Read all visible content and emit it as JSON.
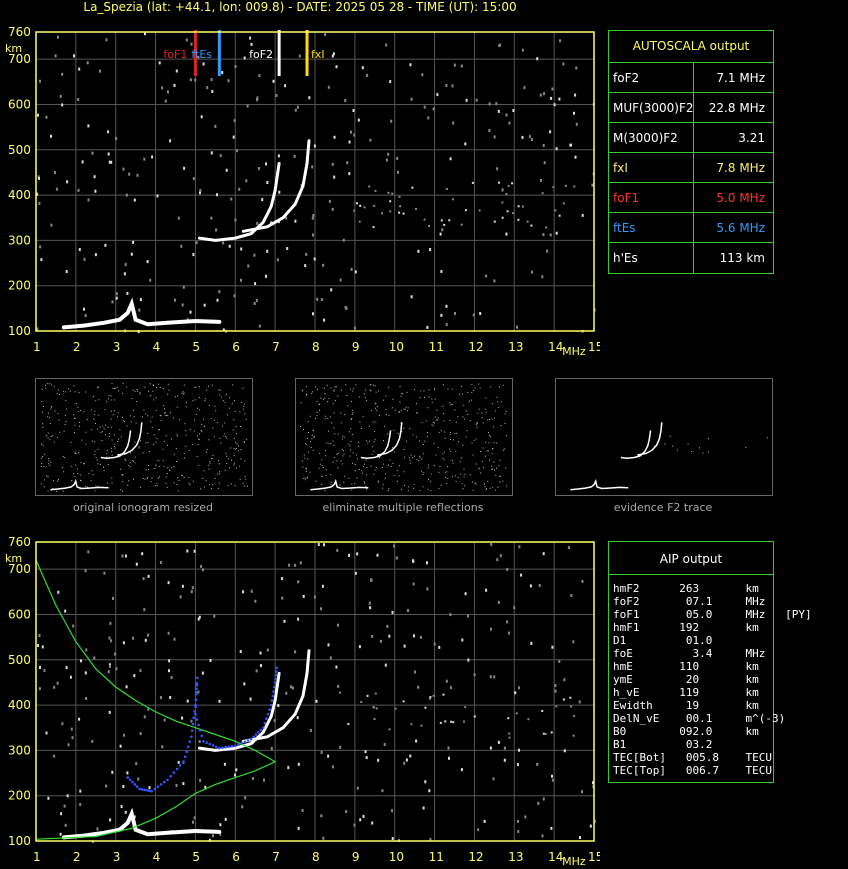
{
  "header": {
    "title": "La_Spezia (lat: +44.1, lon: 009.8) - DATE: 2025 05 28 - TIME (UT): 15:00"
  },
  "axes": {
    "x_ticks": [
      "1",
      "2",
      "3",
      "4",
      "5",
      "6",
      "7",
      "8",
      "9",
      "10",
      "11",
      "12",
      "13",
      "14",
      "15"
    ],
    "x_unit": "MHz",
    "y_ticks": [
      "100",
      "200",
      "300",
      "400",
      "500",
      "600",
      "700",
      "760"
    ],
    "y_unit": "km"
  },
  "markers": {
    "foF1": {
      "label": "foF1",
      "freq": 5.0,
      "color": "#dd2222"
    },
    "ftEs": {
      "label": "ftEs",
      "freq": 5.6,
      "color": "#3399ff"
    },
    "foF2": {
      "label": "foF2",
      "freq": 7.1,
      "color": "#ffffff"
    },
    "fxI": {
      "label": "fxI",
      "freq": 7.8,
      "color": "#ffdd00"
    }
  },
  "autoscala": {
    "title": "AUTOSCALA output",
    "rows": [
      {
        "key": "foF2",
        "value": "7.1 MHz",
        "color": "#ffffff"
      },
      {
        "key": "MUF(3000)F2",
        "value": "22.8 MHz",
        "color": "#ffffff"
      },
      {
        "key": "M(3000)F2",
        "value": "3.21",
        "color": "#ffffff"
      },
      {
        "key": "fxI",
        "value": "7.8 MHz",
        "color": "#ffee66"
      },
      {
        "key": "foF1",
        "value": "5.0 MHz",
        "color": "#ff3333"
      },
      {
        "key": "ftEs",
        "value": "5.6 MHz",
        "color": "#3399ff"
      },
      {
        "key": "h'Es",
        "value": "113    km",
        "color": "#ffffff"
      }
    ]
  },
  "thumbnails": [
    {
      "caption": "original ionogram resized"
    },
    {
      "caption": "eliminate multiple reflections"
    },
    {
      "caption": "evidence F2 trace"
    }
  ],
  "aip": {
    "title": "AIP output",
    "lines": [
      "hmF2      263       km",
      "foF2       07.1     MHz",
      "foF1       05.0     MHz   [PY]",
      "hmF1      192       km",
      "D1         01.0",
      "foE         3.4     MHz",
      "hmE       110       km",
      "ymE        20       km",
      "h_vE      119       km",
      "Ewidth     19       km",
      "DelN_vE    00.1     m^(-3)",
      "B0        092.0     km",
      "B1         03.2",
      "TEC[Bot]   005.8    TECU",
      "TEC[Top]   006.7    TECU"
    ]
  },
  "chart_data": [
    {
      "type": "scatter",
      "xlabel": "MHz",
      "ylabel": "km",
      "xlim": [
        1,
        15
      ],
      "ylim": [
        100,
        760
      ],
      "grid": true,
      "series": [
        {
          "name": "F2 ordinary trace",
          "points": [
            [
              5.1,
              305
            ],
            [
              5.5,
              300
            ],
            [
              6.0,
              305
            ],
            [
              6.4,
              315
            ],
            [
              6.7,
              340
            ],
            [
              6.9,
              375
            ],
            [
              7.0,
              410
            ],
            [
              7.05,
              440
            ],
            [
              7.1,
              470
            ]
          ]
        },
        {
          "name": "F2 extraordinary trace",
          "points": [
            [
              6.2,
              320
            ],
            [
              6.8,
              330
            ],
            [
              7.2,
              350
            ],
            [
              7.5,
              380
            ],
            [
              7.7,
              420
            ],
            [
              7.8,
              470
            ],
            [
              7.85,
              520
            ]
          ]
        },
        {
          "name": "E/Es trace",
          "points": [
            [
              1.7,
              108
            ],
            [
              2.2,
              112
            ],
            [
              2.7,
              118
            ],
            [
              3.1,
              125
            ],
            [
              3.3,
              140
            ],
            [
              3.4,
              160
            ],
            [
              3.5,
              125
            ],
            [
              3.8,
              115
            ],
            [
              4.3,
              118
            ],
            [
              5.0,
              122
            ],
            [
              5.6,
              120
            ]
          ]
        }
      ]
    },
    {
      "type": "line",
      "xlabel": "MHz",
      "ylabel": "km",
      "xlim": [
        1,
        15
      ],
      "ylim": [
        100,
        760
      ],
      "grid": true,
      "series": [
        {
          "name": "electron density profile",
          "points": [
            [
              1.0,
              720
            ],
            [
              1.5,
              620
            ],
            [
              2.0,
              540
            ],
            [
              2.5,
              480
            ],
            [
              3.0,
              440
            ],
            [
              3.5,
              410
            ],
            [
              4.0,
              385
            ],
            [
              4.5,
              365
            ],
            [
              5.0,
              350
            ],
            [
              5.5,
              335
            ],
            [
              6.0,
              320
            ],
            [
              6.5,
              300
            ],
            [
              7.0,
              275
            ],
            [
              6.5,
              255
            ],
            [
              6.0,
              240
            ],
            [
              5.5,
              225
            ],
            [
              5.0,
              205
            ],
            [
              4.5,
              175
            ],
            [
              4.0,
              150
            ],
            [
              3.4,
              128
            ],
            [
              2.5,
              110
            ],
            [
              1.0,
              104
            ]
          ]
        },
        {
          "name": "reconstructed virtual height trace",
          "points": [
            [
              3.3,
              240
            ],
            [
              3.6,
              215
            ],
            [
              3.9,
              210
            ],
            [
              4.3,
              235
            ],
            [
              4.7,
              275
            ],
            [
              4.9,
              330
            ],
            [
              5.0,
              400
            ],
            [
              5.05,
              460
            ],
            [
              5.0,
              380
            ],
            [
              5.2,
              320
            ],
            [
              5.6,
              305
            ],
            [
              6.0,
              310
            ],
            [
              6.4,
              325
            ],
            [
              6.7,
              350
            ],
            [
              6.9,
              400
            ],
            [
              7.0,
              450
            ],
            [
              7.05,
              490
            ]
          ]
        }
      ]
    }
  ]
}
